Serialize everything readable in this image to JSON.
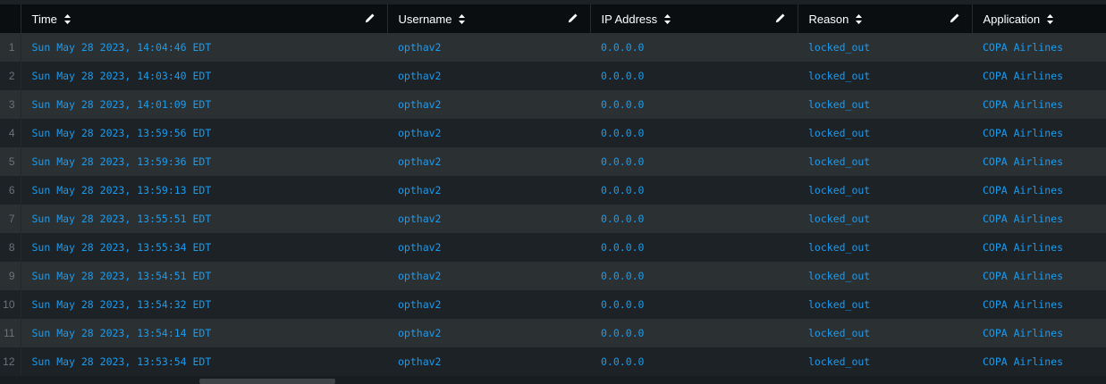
{
  "table": {
    "columns": [
      {
        "key": "time",
        "label": "Time"
      },
      {
        "key": "username",
        "label": "Username"
      },
      {
        "key": "ip",
        "label": "IP Address"
      },
      {
        "key": "reason",
        "label": "Reason"
      },
      {
        "key": "application",
        "label": "Application"
      }
    ],
    "rows": [
      {
        "num": "1",
        "time": "Sun May 28 2023, 14:04:46 EDT",
        "username": "opthav2",
        "ip": "0.0.0.0",
        "reason": "locked_out",
        "application": "COPA Airlines"
      },
      {
        "num": "2",
        "time": "Sun May 28 2023, 14:03:40 EDT",
        "username": "opthav2",
        "ip": "0.0.0.0",
        "reason": "locked_out",
        "application": "COPA Airlines"
      },
      {
        "num": "3",
        "time": "Sun May 28 2023, 14:01:09 EDT",
        "username": "opthav2",
        "ip": "0.0.0.0",
        "reason": "locked_out",
        "application": "COPA Airlines"
      },
      {
        "num": "4",
        "time": "Sun May 28 2023, 13:59:56 EDT",
        "username": "opthav2",
        "ip": "0.0.0.0",
        "reason": "locked_out",
        "application": "COPA Airlines"
      },
      {
        "num": "5",
        "time": "Sun May 28 2023, 13:59:36 EDT",
        "username": "opthav2",
        "ip": "0.0.0.0",
        "reason": "locked_out",
        "application": "COPA Airlines"
      },
      {
        "num": "6",
        "time": "Sun May 28 2023, 13:59:13 EDT",
        "username": "opthav2",
        "ip": "0.0.0.0",
        "reason": "locked_out",
        "application": "COPA Airlines"
      },
      {
        "num": "7",
        "time": "Sun May 28 2023, 13:55:51 EDT",
        "username": "opthav2",
        "ip": "0.0.0.0",
        "reason": "locked_out",
        "application": "COPA Airlines"
      },
      {
        "num": "8",
        "time": "Sun May 28 2023, 13:55:34 EDT",
        "username": "opthav2",
        "ip": "0.0.0.0",
        "reason": "locked_out",
        "application": "COPA Airlines"
      },
      {
        "num": "9",
        "time": "Sun May 28 2023, 13:54:51 EDT",
        "username": "opthav2",
        "ip": "0.0.0.0",
        "reason": "locked_out",
        "application": "COPA Airlines"
      },
      {
        "num": "10",
        "time": "Sun May 28 2023, 13:54:32 EDT",
        "username": "opthav2",
        "ip": "0.0.0.0",
        "reason": "locked_out",
        "application": "COPA Airlines"
      },
      {
        "num": "11",
        "time": "Sun May 28 2023, 13:54:14 EDT",
        "username": "opthav2",
        "ip": "0.0.0.0",
        "reason": "locked_out",
        "application": "COPA Airlines"
      },
      {
        "num": "12",
        "time": "Sun May 28 2023, 13:53:54 EDT",
        "username": "opthav2",
        "ip": "0.0.0.0",
        "reason": "locked_out",
        "application": "COPA Airlines"
      }
    ]
  },
  "colors": {
    "link": "#1a9cf0",
    "header_bg": "#0b0e10",
    "row_odd": "#2b3033",
    "row_even": "#1c2226"
  },
  "icons": {
    "sort": "sort-icon",
    "edit": "pencil-icon"
  }
}
